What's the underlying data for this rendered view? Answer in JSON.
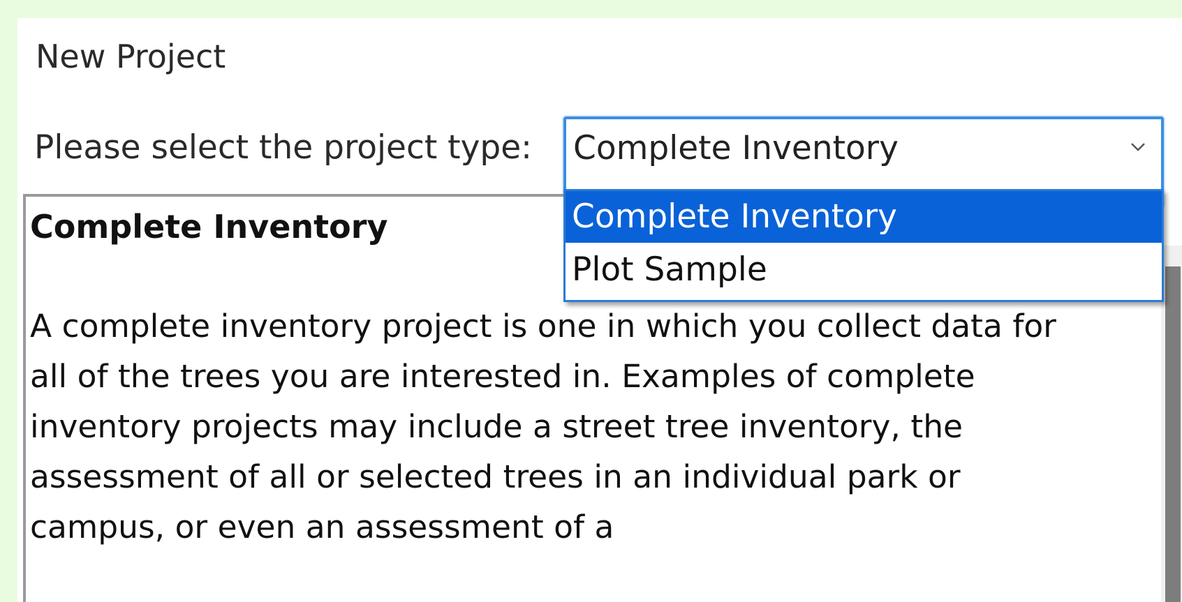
{
  "dialog": {
    "title": "New Project"
  },
  "project_type": {
    "prompt": "Please select the project type:",
    "selected_value": "Complete Inventory",
    "options": [
      "Complete Inventory",
      "Plot Sample"
    ]
  },
  "description": {
    "heading": "Complete Inventory",
    "body": "A complete inventory project is one in which you collect data for all of the trees you are interested in. Examples of complete inventory projects may include a street tree inventory, the assessment of all or selected trees in an individual park or campus, or even an assessment of a"
  },
  "icons": {
    "combo_arrow": "chevron-down-icon"
  },
  "colors": {
    "background": "#eafce0",
    "accent": "#0a62d8",
    "focus_border": "#3b8fe0"
  }
}
